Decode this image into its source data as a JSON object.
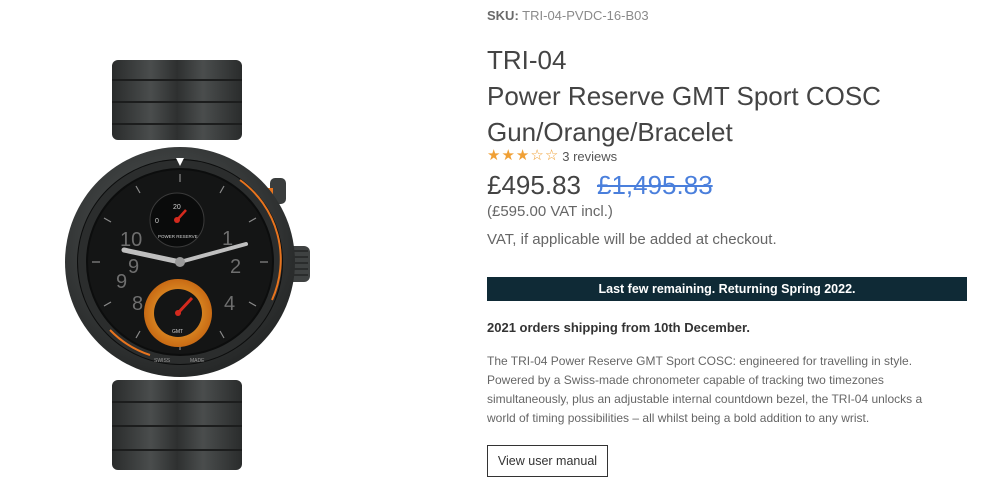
{
  "product": {
    "sku_label": "SKU:",
    "sku_value": "TRI-04-PVDC-16-B03",
    "title_lines": [
      "TRI-04",
      "Power Reserve GMT Sport COSC",
      "Gun/Orange/Bracelet"
    ],
    "rating": {
      "stars": 3,
      "max": 5,
      "reviews_label": "3 reviews"
    },
    "price": "£495.83",
    "old_price": "£1,495.83",
    "vat_incl": "(£595.00 VAT incl.)",
    "vat_note": "VAT, if applicable will be added at checkout.",
    "stock_banner": "Last few remaining. Returning Spring 2022.",
    "shipping_note": "2021 orders shipping from 10th December.",
    "description_lines": [
      "The TRI-04 Power Reserve GMT Sport COSC: engineered for travelling in style.",
      "Powered by a Swiss-made chronometer capable of tracking two timezones",
      "simultaneously, plus an adjustable internal countdown bezel, the TRI-04 unlocks a",
      "world of timing possibilities – all whilst being a bold addition to any wrist."
    ],
    "manual_button": "View user manual"
  },
  "watch": {
    "dial_labels": {
      "power_reserve": "POWER RESERVE",
      "power_reserve_top": "20",
      "power_reserve_left": "0",
      "gmt": "GMT",
      "swiss": "SWISS",
      "made": "MADE"
    },
    "colors": {
      "case": "#3a3d3d",
      "dial": "#141515",
      "accent_orange": "#e8741e",
      "accent_red": "#d42a1e"
    }
  }
}
